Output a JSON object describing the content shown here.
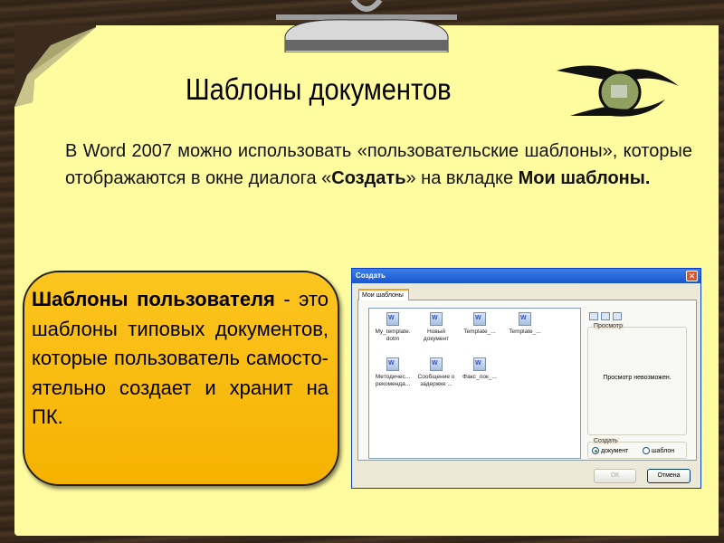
{
  "slide": {
    "title": "Шаблоны документов",
    "intro": {
      "part1": "В Word 2007 можно использовать «пользовательские шаблоны», которые отображаются в окне диалога «",
      "bold1": "Создать",
      "part2": "» на вкладке ",
      "bold2": "Мои шаблоны."
    },
    "callout": {
      "bold": "Шаблоны пользователя",
      "text": " - это шаблоны типовых документов, которые пользователь самосто-ятельно создает и хранит на ПК."
    },
    "colors": {
      "paper": "#fffb9f",
      "callout": "#f9bc10",
      "background": "#3b2b1c"
    }
  },
  "dialog": {
    "title": "Создать",
    "close_icon": "close-icon",
    "tab": "Мои шаблоны",
    "items": [
      {
        "label": "My_template. dotm"
      },
      {
        "label": "Новый документ"
      },
      {
        "label": "Template_..."
      },
      {
        "label": "Template_..."
      },
      {
        "label": "Методичес... рекоменда..."
      },
      {
        "label": "Сообщение о задержке ..."
      },
      {
        "label": "Факс_лок_..."
      }
    ],
    "preview_label": "Просмотр",
    "preview_text": "Просмотр невозможен.",
    "create_label": "Создать",
    "radio_document": "документ",
    "radio_template": "шаблон",
    "selected": "документ",
    "ok": "ОК",
    "cancel": "Отмена"
  }
}
